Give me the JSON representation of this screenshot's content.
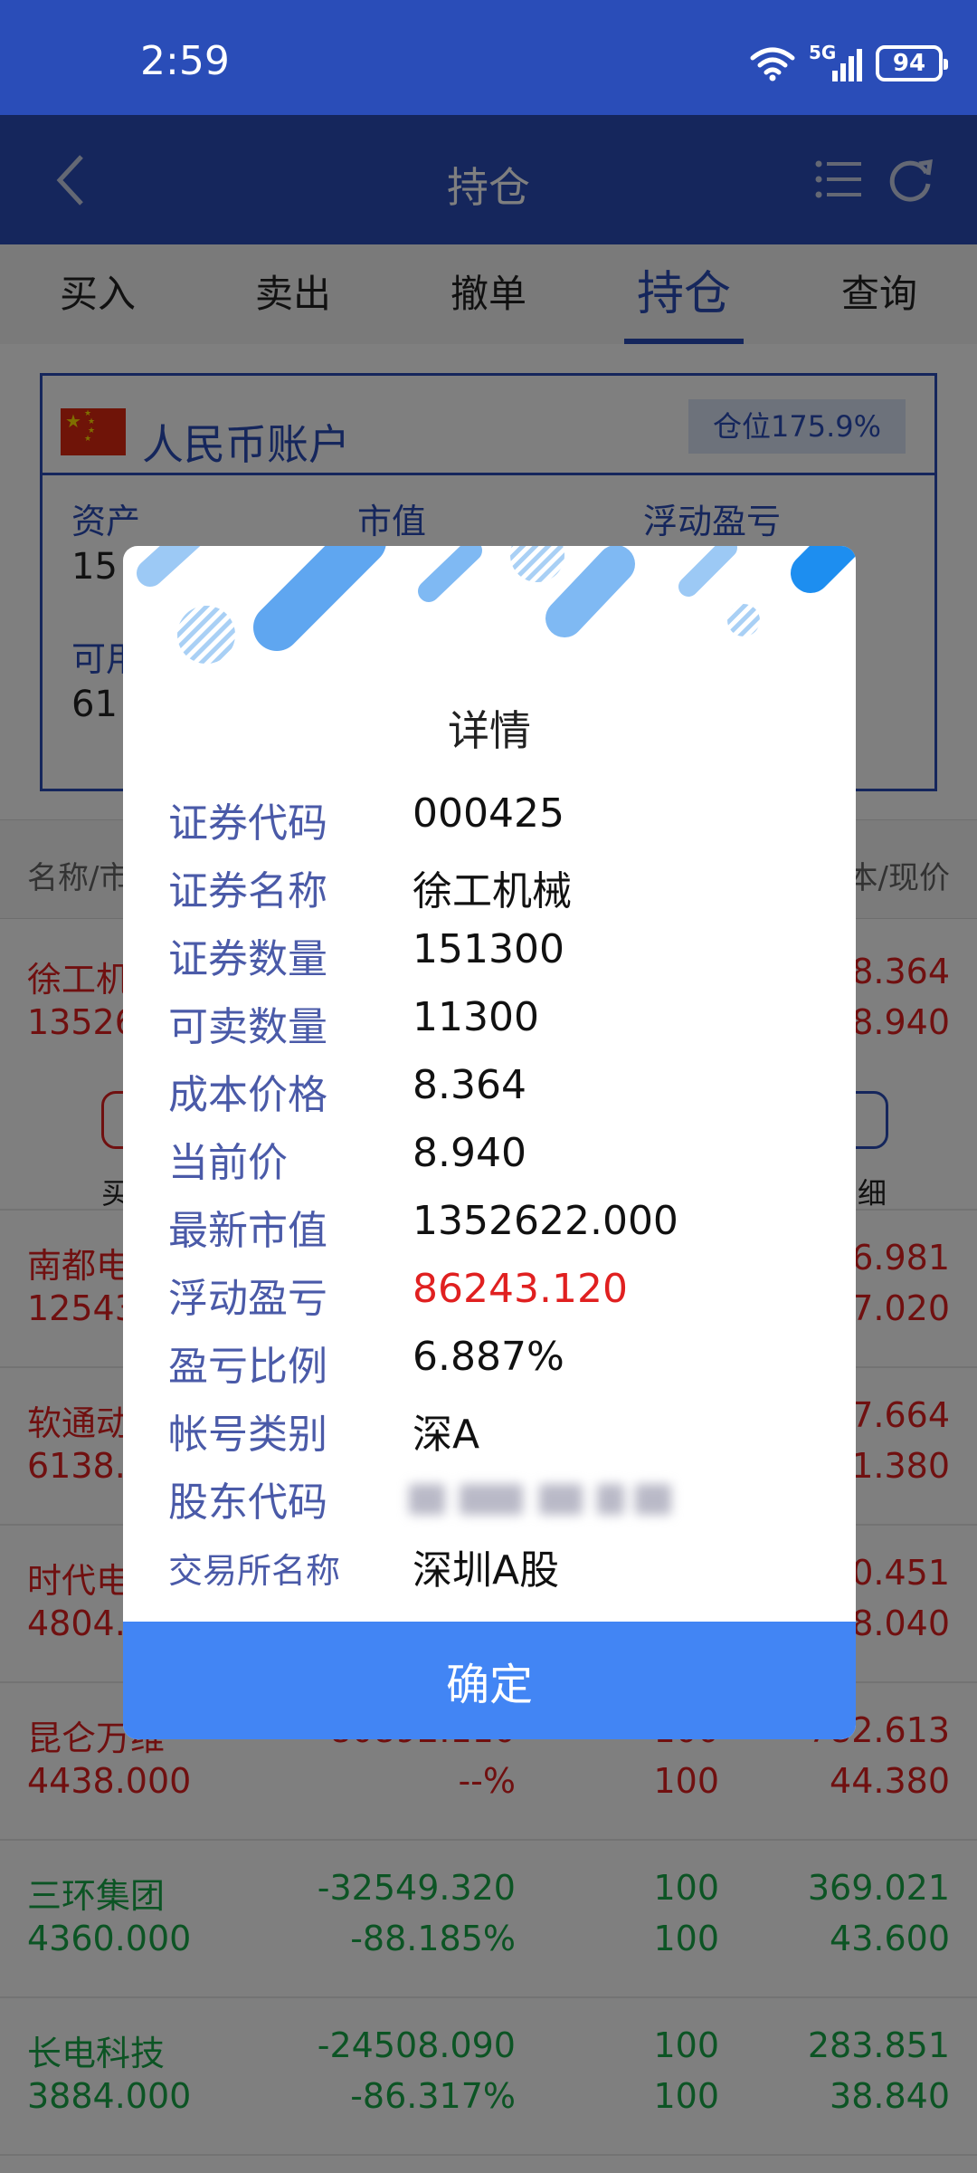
{
  "status_bar": {
    "time": "2:59",
    "battery": "94",
    "network": "5G"
  },
  "nav": {
    "title": "持仓",
    "back_icon": "chevron-left-icon",
    "list_icon": "list-icon",
    "refresh_icon": "refresh-icon"
  },
  "tabs": [
    {
      "label": "买入",
      "active": false
    },
    {
      "label": "卖出",
      "active": false
    },
    {
      "label": "撤单",
      "active": false
    },
    {
      "label": "持仓",
      "active": true
    },
    {
      "label": "查询",
      "active": false
    }
  ],
  "account": {
    "title": "人民币账户",
    "position": "仓位175.9%",
    "asset_label": "资产",
    "asset_value": "15",
    "market_value_label": "市值",
    "floating_pl_label": "浮动盈亏",
    "available_label": "可用",
    "available_value": "61"
  },
  "list_header": {
    "left": "名称/市",
    "right": "本/现价"
  },
  "first_row": {
    "name": "徐工机",
    "market_value": "13526",
    "cost": "8.364",
    "price": "8.940",
    "buy_label": "买",
    "detail_label": "细"
  },
  "rows": [
    {
      "name": "南都电",
      "value": "12543",
      "cost": "6.981",
      "price": "7.020",
      "color": "red"
    },
    {
      "name": "软通动",
      "value": "6138.",
      "cost": "7.664",
      "price": "1.380",
      "color": "red"
    },
    {
      "name": "时代电",
      "value": "4804.",
      "cost": "0.451",
      "price": "8.040",
      "color": "red"
    },
    {
      "name": "昆仑万维",
      "value": "4438.000",
      "pl": "80892.110",
      "ratio": "--%",
      "qty1": "100",
      "qty2": "100",
      "cost": "-782.613",
      "price": "44.380",
      "color": "red"
    },
    {
      "name": "三环集团",
      "value": "4360.000",
      "pl": "-32549.320",
      "ratio": "-88.185%",
      "qty1": "100",
      "qty2": "100",
      "cost": "369.021",
      "price": "43.600",
      "color": "green"
    },
    {
      "name": "长电科技",
      "value": "3884.000",
      "pl": "-24508.090",
      "ratio": "-86.317%",
      "qty1": "100",
      "qty2": "100",
      "cost": "283.851",
      "price": "38.840",
      "color": "green"
    }
  ],
  "dialog": {
    "title": "详情",
    "fields": [
      {
        "label": "证券代码",
        "value": "000425"
      },
      {
        "label": "证券名称",
        "value": "徐工机械"
      },
      {
        "label": "证券数量",
        "value": "151300"
      },
      {
        "label": "可卖数量",
        "value": "11300"
      },
      {
        "label": "成本价格",
        "value": "8.364"
      },
      {
        "label": "当前价",
        "value": "8.940"
      },
      {
        "label": "最新市值",
        "value": "1352622.000"
      },
      {
        "label": "浮动盈亏",
        "value": "86243.120"
      },
      {
        "label": "盈亏比例",
        "value": "6.887%"
      },
      {
        "label": "帐号类别",
        "value": "深A"
      },
      {
        "label": "股东代码",
        "value": ""
      },
      {
        "label": "交易所名称",
        "value": "深圳A股"
      }
    ],
    "confirm": "确定"
  },
  "colors": {
    "primary": "#2a4db8",
    "confirm": "#4285f4",
    "red": "#e02020",
    "green": "#18a848",
    "label": "#4a5aa8"
  }
}
